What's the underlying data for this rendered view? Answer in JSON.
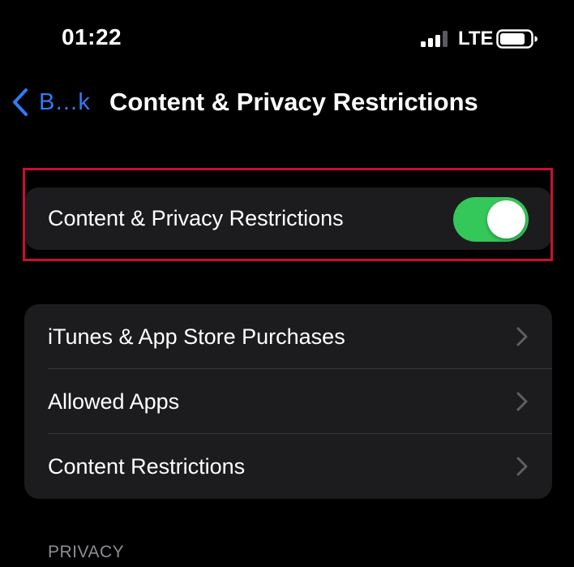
{
  "status_bar": {
    "time": "01:22",
    "network": "LTE",
    "signal_bars_active": 3,
    "signal_bars_total": 4,
    "battery_level": 0.75
  },
  "nav": {
    "back_label": "B…k",
    "title": "Content & Privacy Restrictions"
  },
  "toggle_setting": {
    "label": "Content & Privacy Restrictions",
    "enabled": true
  },
  "settings_list": [
    {
      "label": "iTunes & App Store Purchases"
    },
    {
      "label": "Allowed Apps"
    },
    {
      "label": "Content Restrictions"
    }
  ],
  "section_header": "PRIVACY",
  "colors": {
    "accent_blue": "#2f7cf6",
    "toggle_on": "#34c759",
    "cell_bg": "#1c1c1e",
    "highlight": "#c8102e"
  }
}
